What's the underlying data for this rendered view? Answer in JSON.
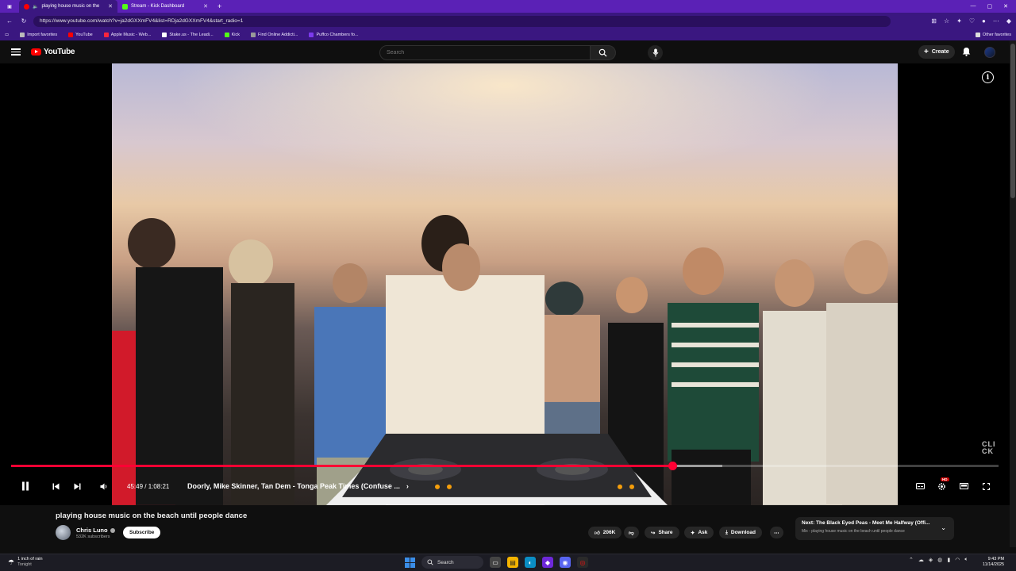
{
  "browser": {
    "tabs": [
      {
        "label": "playing house music on the",
        "active": true
      },
      {
        "label": "Stream - Kick Dashboard",
        "active": false
      }
    ],
    "url": "https://www.youtube.com/watch?v=ja2dGXXmFV4&list=RDja2dGXXmFV4&start_radio=1",
    "bookmarks": [
      "Import favorites",
      "YouTube",
      "Apple Music - Web...",
      "Stake.us - The Leadi...",
      "Kick",
      "Find Online Addicti...",
      "Puffco Chambers fo..."
    ],
    "other_favorites": "Other favorites"
  },
  "youtube": {
    "logo_text": "YouTube",
    "search_placeholder": "Search",
    "create_label": "Create"
  },
  "player": {
    "time_current": "45:49",
    "time_total": "1:08:21",
    "time_display": "45:49 / 1:08:21",
    "progress_fraction": 0.67,
    "buffered_fraction": 0.72,
    "chapter_title": "Doorly, Mike Skinner, Tan Dem - Tonga Peak Times (Confuse ...",
    "watermark": "CLI CK",
    "hd_badge": "HD"
  },
  "video": {
    "title": "playing house music on the beach until people dance",
    "channel": "Chris Luno",
    "subscribers": "532K subscribers",
    "subscribe_label": "Subscribe",
    "likes": "206K",
    "share_label": "Share",
    "ask_label": "Ask",
    "download_label": "Download",
    "next_title": "Next: The Black Eyed Peas - Meet Me Halfway (Offi...",
    "next_sub": "Mix - playing house music on the beach until people dance"
  },
  "taskbar": {
    "weather_line1": "1 inch of rain",
    "weather_line2": "Tonight",
    "search_label": "Search",
    "time": "9:43 PM",
    "date": "11/14/2025"
  },
  "colors": {
    "browser_purple": "#5b21b6",
    "yt_red": "#ff0000",
    "progress_red": "#ff0033",
    "background": "#0f0f0f"
  }
}
